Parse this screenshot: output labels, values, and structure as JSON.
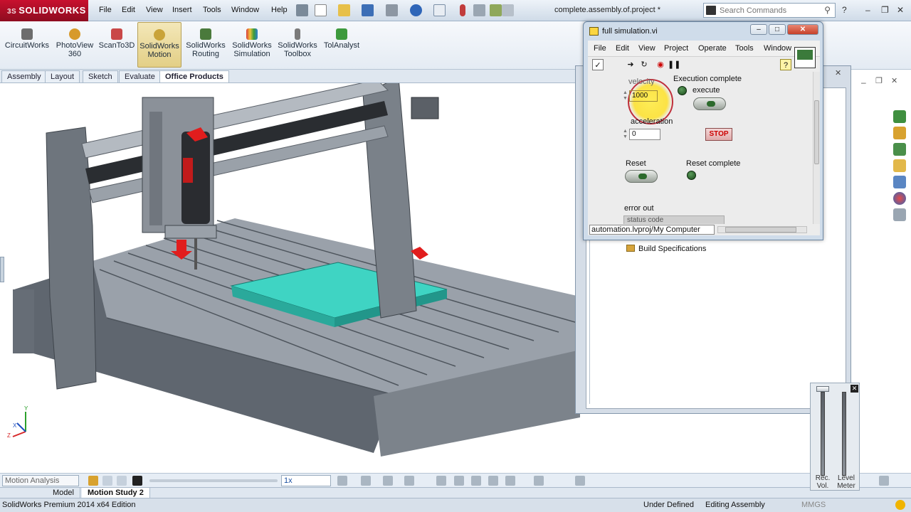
{
  "app": {
    "brand": "SOLIDWORKS",
    "document_title": "complete.assembly.of.project *",
    "menus": [
      "File",
      "Edit",
      "View",
      "Insert",
      "Tools",
      "Window",
      "Help"
    ],
    "search_placeholder": "Search Commands",
    "help_glyph": "?"
  },
  "command_manager": {
    "items": [
      {
        "label1": "CircuitWorks",
        "label2": "",
        "icon": "circuitworks-icon",
        "color": "#6d6d6d"
      },
      {
        "label1": "PhotoView",
        "label2": "360",
        "icon": "photoview-icon",
        "color": "#d79a2b"
      },
      {
        "label1": "ScanTo3D",
        "label2": "",
        "icon": "scanto3d-icon",
        "color": "#c94848"
      },
      {
        "label1": "SolidWorks",
        "label2": "Motion",
        "icon": "motion-icon",
        "color": "#c9a339"
      },
      {
        "label1": "SolidWorks",
        "label2": "Routing",
        "icon": "routing-icon",
        "color": "#4a7a3c"
      },
      {
        "label1": "SolidWorks",
        "label2": "Simulation",
        "icon": "simulation-icon",
        "color": "#2f7fd0"
      },
      {
        "label1": "SolidWorks",
        "label2": "Toolbox",
        "icon": "toolbox-icon",
        "color": "#7a7a7a"
      },
      {
        "label1": "TolAnalyst",
        "label2": "",
        "icon": "tolanalyst-icon",
        "color": "#3d9a3d"
      }
    ]
  },
  "tabs": [
    "Assembly",
    "Layout",
    "Sketch",
    "Evaluate",
    "Office Products"
  ],
  "active_tab": "Office Products",
  "viewport": {
    "axis_labels": {
      "x": "X",
      "y": "Y",
      "z": "Z"
    }
  },
  "motion_manager": {
    "analysis_type": "Motion Analysis",
    "playback_speed": "1x"
  },
  "study_tabs": [
    "Model",
    "Motion Study 2"
  ],
  "active_study": "Motion Study 2",
  "status_bar": {
    "edition": "SolidWorks Premium 2014 x64 Edition",
    "state": "Under Defined",
    "mode": "Editing Assembly",
    "units": "MMGS"
  },
  "project_window": {
    "tree_item": "Build Specifications"
  },
  "vi_window": {
    "title": "full simulation.vi",
    "menus": [
      "File",
      "Edit",
      "View",
      "Project",
      "Operate",
      "Tools",
      "Window"
    ],
    "toolbar_icons": [
      "run-icon",
      "run-continuously-icon",
      "abort-icon",
      "pause-icon"
    ],
    "controls": {
      "velocity_label": "velocity",
      "velocity_value": "1000",
      "acceleration_label": "acceleration",
      "acceleration_value": "0",
      "execute_label": "execute",
      "execution_complete_label": "Execution complete",
      "stop_label": "STOP",
      "reset_label": "Reset",
      "reset_complete_label": "Reset complete",
      "error_out_label": "error out",
      "error_cluster_text": "status    code"
    },
    "path": "automation.lvproj/My Computer"
  },
  "mixer": {
    "rec_vol_label": "Rec. Vol.",
    "level_meter_label": "Level Meter"
  },
  "colors": {
    "solidworks_red": "#c8102e",
    "part_teal": "#33d0bf",
    "frame_gray": "#8e959e",
    "highlight_yellow": "#ffe23a"
  }
}
